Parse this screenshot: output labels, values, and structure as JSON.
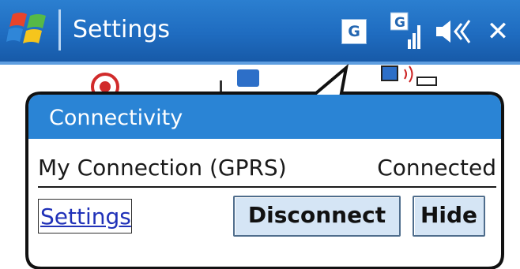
{
  "titlebar": {
    "title": "Settings",
    "network_badge": "G",
    "icons": [
      "windows-start-icon",
      "network-g-icon",
      "gprs-signal-icon",
      "volume-icon",
      "close-icon"
    ],
    "close_label": "✕"
  },
  "popup": {
    "header": "Connectivity",
    "connection_name": "My Connection (GPRS)",
    "connection_status": "Connected",
    "settings_link": "Settings",
    "disconnect_button": "Disconnect",
    "hide_button": "Hide"
  },
  "colors": {
    "titlebar": "#1f6cc0",
    "popup_header": "#2a84d5",
    "link": "#2031b8",
    "button_face": "#d5e5f5"
  }
}
